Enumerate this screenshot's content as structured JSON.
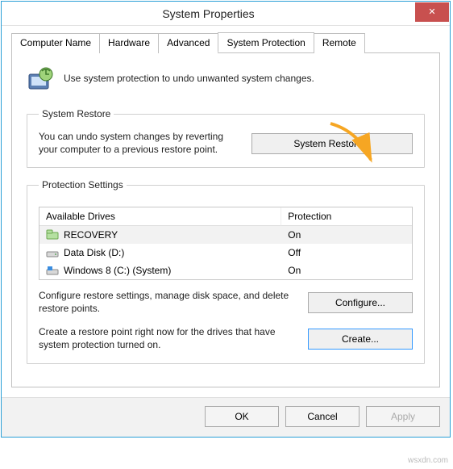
{
  "window": {
    "title": "System Properties",
    "close_icon": "✕"
  },
  "tabs": [
    {
      "label": "Computer Name"
    },
    {
      "label": "Hardware"
    },
    {
      "label": "Advanced"
    },
    {
      "label": "System Protection",
      "active": true
    },
    {
      "label": "Remote"
    }
  ],
  "intro_text": "Use system protection to undo unwanted system changes.",
  "restore": {
    "legend": "System Restore",
    "text": "You can undo system changes by reverting your computer to a previous restore point.",
    "button": "System Restore..."
  },
  "protection": {
    "legend": "Protection Settings",
    "columns": {
      "drive": "Available Drives",
      "prot": "Protection"
    },
    "rows": [
      {
        "name": "RECOVERY",
        "prot": "On",
        "selected": true,
        "icon": "drive-green"
      },
      {
        "name": "Data Disk (D:)",
        "prot": "Off",
        "selected": false,
        "icon": "drive"
      },
      {
        "name": "Windows 8 (C:) (System)",
        "prot": "On",
        "selected": false,
        "icon": "drive-win"
      }
    ],
    "configure_text": "Configure restore settings, manage disk space, and delete restore points.",
    "configure_button": "Configure...",
    "create_text": "Create a restore point right now for the drives that have system protection turned on.",
    "create_button": "Create..."
  },
  "footer": {
    "ok": "OK",
    "cancel": "Cancel",
    "apply": "Apply"
  },
  "watermark": "wsxdn.com"
}
